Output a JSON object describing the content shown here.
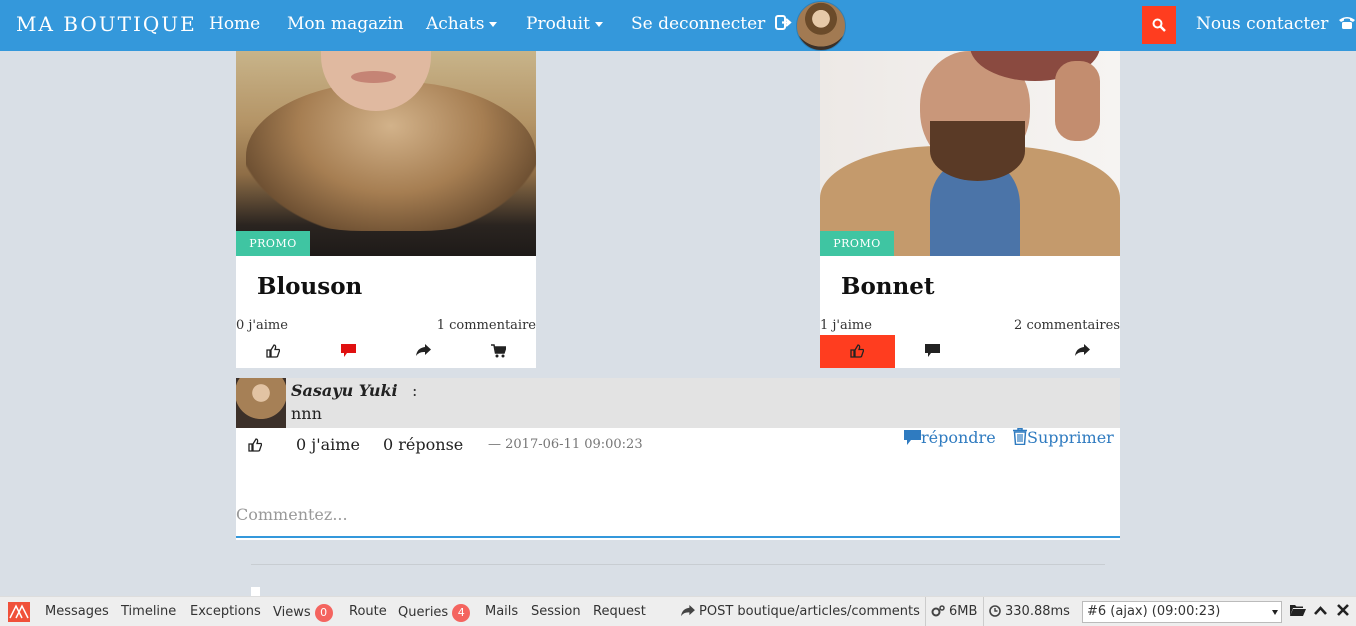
{
  "navbar": {
    "brand": "MA BOUTIQUE",
    "items": [
      {
        "label": "Home"
      },
      {
        "label": "Mon magazin"
      },
      {
        "label": "Achats"
      },
      {
        "label": "Produit"
      },
      {
        "label": "Se deconnecter"
      }
    ],
    "contact_label": "Nous contacter",
    "accent_color": "#3498db",
    "search_color": "#ff3d1f"
  },
  "products": [
    {
      "badge": "PROMO",
      "title": "Blouson",
      "likes": "0 j'aime",
      "comments": "1 commentaire",
      "liked": false
    },
    {
      "badge": "PROMO",
      "title": "Bonnet",
      "likes": "1 j'aime",
      "comments": "2 commentaires",
      "liked": true
    }
  ],
  "comment": {
    "author": "Sasayu  Yuki",
    "separator": ":",
    "text": "nnn",
    "likes": "0 j'aime",
    "replies": "0 réponse",
    "date": "— 2017-06-11 09:00:23",
    "reply_label": "répondre",
    "delete_label": "Supprimer",
    "input_placeholder": "Commentez..."
  },
  "debugbar": {
    "tabs": [
      {
        "label": "Messages"
      },
      {
        "label": "Timeline"
      },
      {
        "label": "Exceptions"
      },
      {
        "label": "Views",
        "badge": "0"
      },
      {
        "label": "Route"
      },
      {
        "label": "Queries",
        "badge": "4"
      },
      {
        "label": "Mails"
      },
      {
        "label": "Session"
      },
      {
        "label": "Request"
      }
    ],
    "request": "POST boutique/articles/comments",
    "memory": "6MB",
    "time": "330.88ms",
    "selected_request": "#6 (ajax) (09:00:23)"
  }
}
